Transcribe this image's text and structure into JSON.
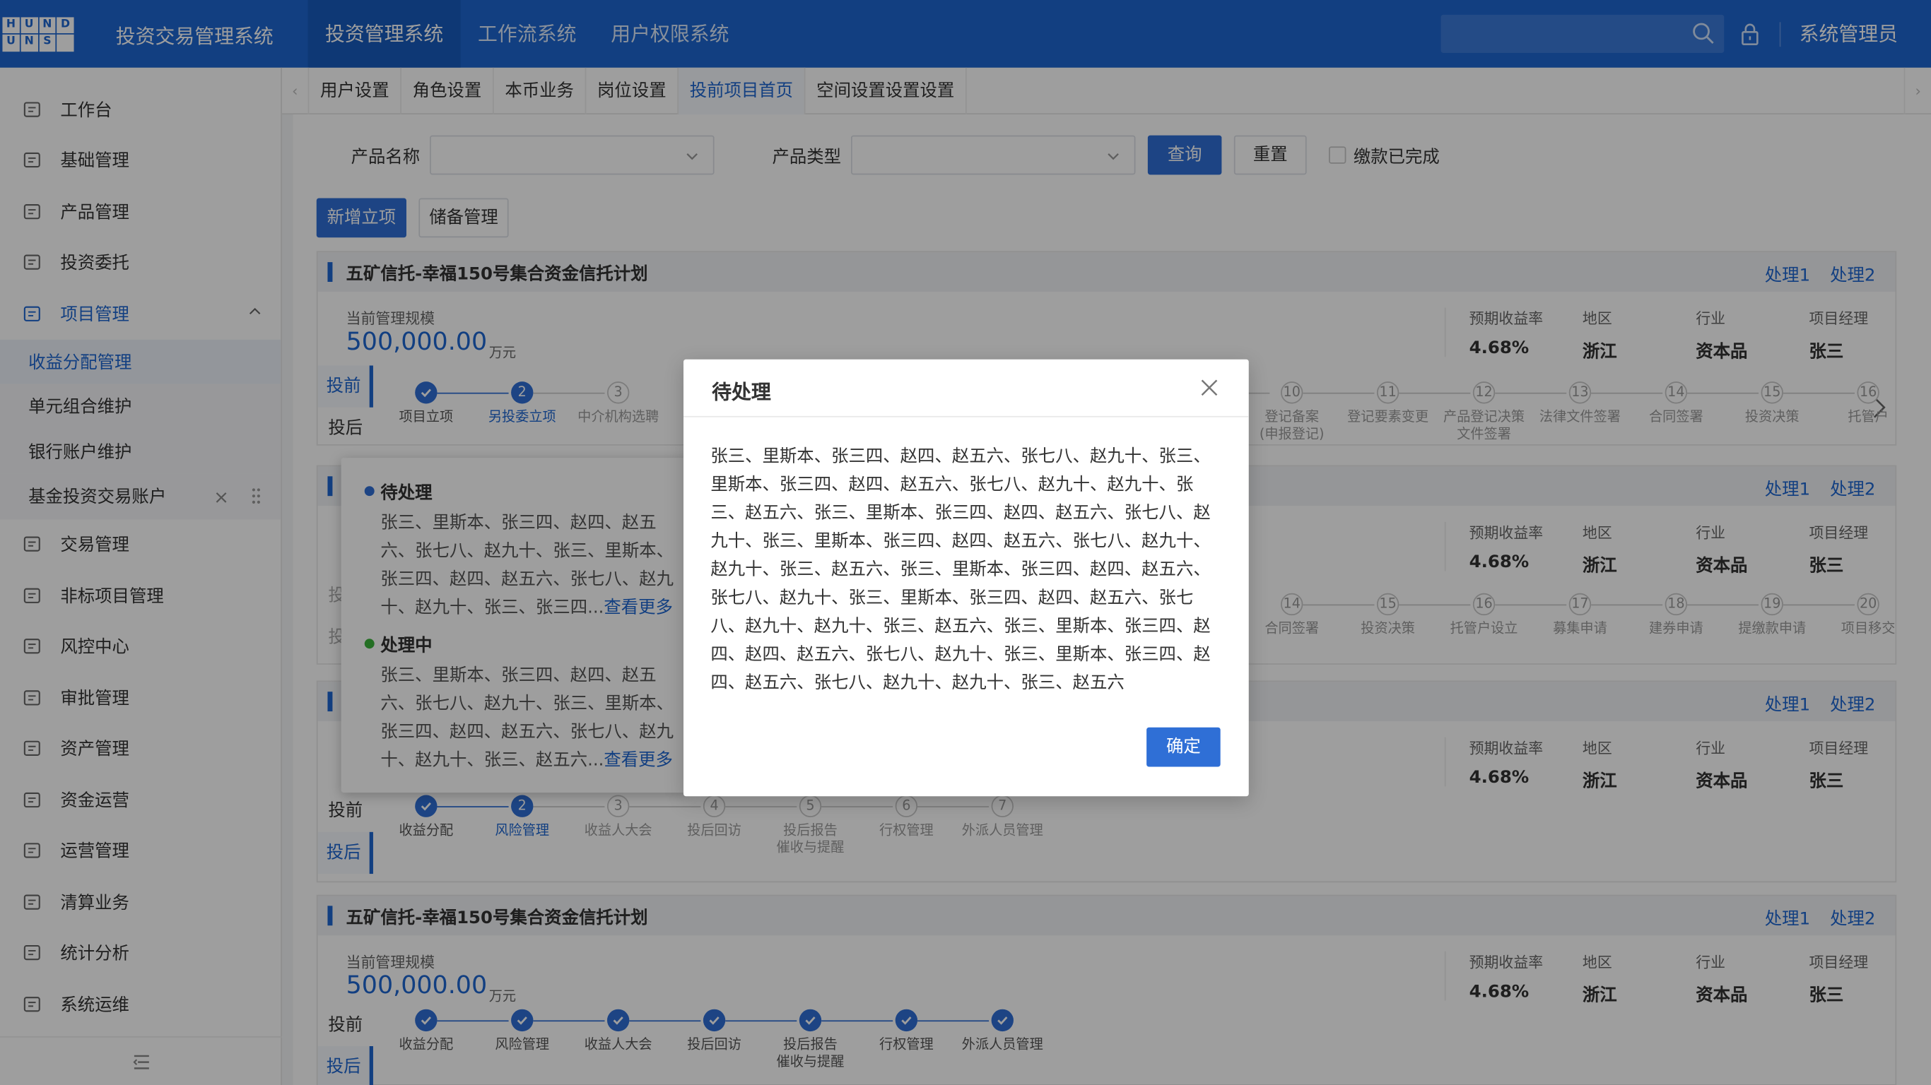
{
  "header": {
    "logo_letters": [
      "H",
      "U",
      "N",
      "D",
      "U",
      "N",
      "S",
      ""
    ],
    "app_title": "投资交易管理系统",
    "nav": [
      "投资管理系统",
      "工作流系统",
      "用户权限系统"
    ],
    "user": "系统管理员"
  },
  "sidebar": {
    "items": [
      {
        "label": "工作台",
        "icon": "monitor-icon"
      },
      {
        "label": "基础管理",
        "icon": "cube-icon"
      },
      {
        "label": "产品管理",
        "icon": "grid-icon"
      },
      {
        "label": "投资委托",
        "icon": "document-edit-icon"
      },
      {
        "label": "项目管理",
        "icon": "project-icon"
      }
    ],
    "sub_items": [
      "收益分配管理",
      "单元组合维护",
      "银行账户维护",
      "基金投资交易账户"
    ],
    "items2": [
      {
        "label": "交易管理",
        "icon": "exchange-icon"
      },
      {
        "label": "非标项目管理",
        "icon": "list-icon"
      },
      {
        "label": "风控中心",
        "icon": "shield-icon"
      },
      {
        "label": "审批管理",
        "icon": "approve-icon"
      },
      {
        "label": "资产管理",
        "icon": "database-icon"
      },
      {
        "label": "资金运营",
        "icon": "yen-icon"
      },
      {
        "label": "运营管理",
        "icon": "file-icon"
      },
      {
        "label": "清算业务",
        "icon": "settle-icon"
      },
      {
        "label": "统计分析",
        "icon": "chart-icon"
      },
      {
        "label": "系统运维",
        "icon": "gear-icon"
      }
    ]
  },
  "tabs": [
    "用户设置",
    "角色设置",
    "本币业务",
    "岗位设置",
    "投前项目首页",
    "空间设置设置设置"
  ],
  "filter": {
    "product_name_label": "产品名称",
    "product_type_label": "产品类型",
    "query": "查询",
    "reset": "重置",
    "paid_label": "缴款已完成",
    "add": "新增立项",
    "reserve": "储备管理"
  },
  "card": {
    "title": "五矿信托-幸福150号集合资金信托计划",
    "action1": "处理1",
    "action2": "处理2",
    "scale_label": "当前管理规模",
    "amount": "500,000.00",
    "unit": "万元",
    "yield_label": "预期收益率",
    "yield": "4.68%",
    "region_label": "地区",
    "region": "浙江",
    "industry_label": "行业",
    "industry": "资本品",
    "manager_label": "项目经理",
    "manager": "张三",
    "phase_pre": "投前",
    "phase_post": "投后"
  },
  "steps_pre": [
    {
      "n": "",
      "label": "项目立项",
      "state": "done"
    },
    {
      "n": "2",
      "label": "另投委立项",
      "state": "cur"
    },
    {
      "n": "3",
      "label": "中介机构选聘",
      "state": "todo"
    }
  ],
  "steps_pre_tail": [
    {
      "n": "10",
      "label": "登记备案\n(申报登记)"
    },
    {
      "n": "11",
      "label": "登记要素变更"
    },
    {
      "n": "12",
      "label": "产品登记决策\n文件签署"
    },
    {
      "n": "13",
      "label": "法律文件签署"
    },
    {
      "n": "14",
      "label": "合同签署"
    },
    {
      "n": "15",
      "label": "投资决策"
    },
    {
      "n": "16",
      "label": "托管户"
    }
  ],
  "steps_card2_tail": [
    {
      "n": "14",
      "label": "合同签署"
    },
    {
      "n": "15",
      "label": "投资决策"
    },
    {
      "n": "16",
      "label": "托管户设立"
    },
    {
      "n": "17",
      "label": "募集申请"
    },
    {
      "n": "18",
      "label": "建券申请"
    },
    {
      "n": "19",
      "label": "提缴款申请"
    },
    {
      "n": "20",
      "label": "项目移交"
    }
  ],
  "steps_post": [
    {
      "n": "",
      "label": "收益分配",
      "state": "done"
    },
    {
      "n": "2",
      "label": "风险管理",
      "state": "cur"
    },
    {
      "n": "3",
      "label": "收益人大会",
      "state": "todo"
    },
    {
      "n": "4",
      "label": "投后回访",
      "state": "todo"
    },
    {
      "n": "5",
      "label": "投后报告\n催收与提醒",
      "state": "todo"
    },
    {
      "n": "6",
      "label": "行权管理",
      "state": "todo"
    },
    {
      "n": "7",
      "label": "外派人员管理",
      "state": "todo"
    }
  ],
  "steps_post_done": [
    {
      "label": "收益分配"
    },
    {
      "label": "风险管理"
    },
    {
      "label": "收益人大会"
    },
    {
      "label": "投后回访"
    },
    {
      "label": "投后报告\n催收与提醒"
    },
    {
      "label": "行权管理"
    },
    {
      "label": "外派人员管理"
    }
  ],
  "popover": {
    "pending_title": "待处理",
    "pending_text": "张三、里斯本、张三四、赵四、赵五六、张七八、赵九十、张三、里斯本、张三四、赵四、赵五六、张七八、赵九十、赵九十、张三、张三四...",
    "processing_title": "处理中",
    "processing_text": "张三、里斯本、张三四、赵四、赵五六、张七八、赵九十、张三、里斯本、张三四、赵四、赵五六、张七八、赵九十、赵九十、张三、赵五六...",
    "more": "查看更多",
    "pending_color": "#2f6fd6",
    "processing_color": "#3bb33b"
  },
  "modal": {
    "title": "待处理",
    "body": "张三、里斯本、张三四、赵四、赵五六、张七八、赵九十、张三、里斯本、张三四、赵四、赵五六、张七八、赵九十、赵九十、张三、赵五六、张三、里斯本、张三四、赵四、赵五六、张七八、赵九十、张三、里斯本、张三四、赵四、赵五六、张七八、赵九十、赵九十、张三、赵五六、张三、里斯本、张三四、赵四、赵五六、张七八、赵九十、张三、里斯本、张三四、赵四、赵五六、张七八、赵九十、赵九十、张三、赵五六、张三、里斯本、张三四、赵四、赵四、赵五六、张七八、赵九十、张三、里斯本、张三四、赵四、赵五六、张七八、赵九十、赵九十、张三、赵五六",
    "ok": "确定"
  },
  "colors": {
    "brand": "#1d66d1",
    "primary": "#2f6fd6"
  }
}
